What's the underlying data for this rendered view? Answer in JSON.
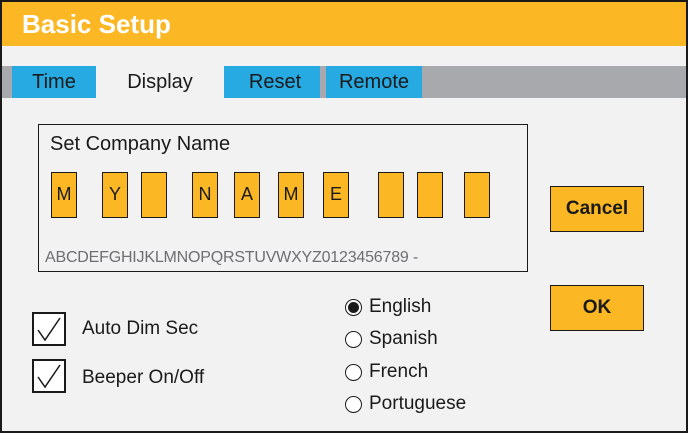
{
  "window": {
    "title": "Basic Setup"
  },
  "tabs": [
    {
      "label": "Time"
    },
    {
      "label": "Display"
    },
    {
      "label": "Reset"
    },
    {
      "label": "Remote"
    }
  ],
  "company_name": {
    "title": "Set Company Name",
    "chars": [
      "M",
      "Y",
      "",
      "N",
      "A",
      "M",
      "E",
      "",
      "",
      ""
    ],
    "charset": "ABCDEFGHIJKLMNOPQRSTUVWXYZ0123456789 -"
  },
  "options": {
    "auto_dim": {
      "label": "Auto Dim Sec",
      "checked": true
    },
    "beeper": {
      "label": "Beeper On/Off",
      "checked": true
    }
  },
  "language": {
    "selected": "English",
    "items": [
      "English",
      "Spanish",
      "French",
      "Portuguese"
    ]
  },
  "buttons": {
    "cancel": "Cancel",
    "ok": "OK"
  },
  "colors": {
    "accent": "#fbb824",
    "tab_blue": "#27a9e1",
    "tab_bar": "#a7a9ac",
    "panel": "#f2f2f2"
  }
}
